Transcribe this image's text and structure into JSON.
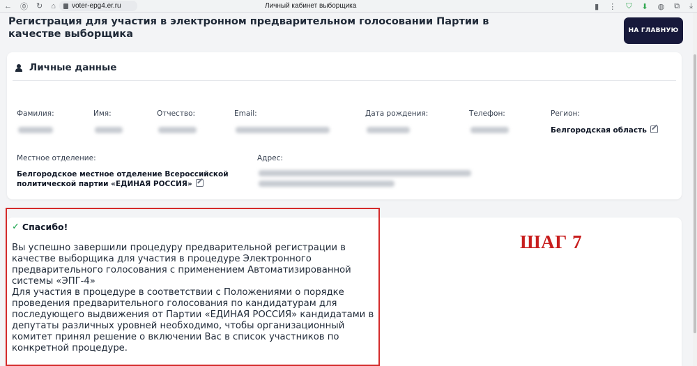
{
  "browser": {
    "url": "voter-epg4.er.ru",
    "tab_title": "Личный кабинет выборщика"
  },
  "header": {
    "title": "Регистрация для участия в электронном предварительном голосовании Партии в качестве выборщика",
    "home_button": "НА ГЛАВНУЮ"
  },
  "personal": {
    "heading": "Личные данные",
    "fields": {
      "surname_label": "Фамилия:",
      "name_label": "Имя:",
      "patronymic_label": "Отчество:",
      "email_label": "Email:",
      "birthdate_label": "Дата рождения:",
      "phone_label": "Телефон:",
      "region_label": "Регион:",
      "region_value": "Белгородская область",
      "branch_label": "Местное отделение:",
      "branch_value": "Белгородское местное отделение Всероссийской политической партии «ЕДИНАЯ РОССИЯ»",
      "address_label": "Адрес:"
    }
  },
  "thanks": {
    "title": "Спасибо!",
    "paragraph1": "Вы успешно завершили процедуру предварительной регистрации в качестве выборщика для участия в процедуре Электронного предварительного голосования с применением Автоматизированной системы «ЭПГ-4»",
    "paragraph2": "Для участия в процедуре в соответствии с Положениями о порядке проведения предварительного голосования по кандидатурам для последующего выдвижения от Партии «ЕДИНАЯ РОССИЯ» кандидатами в депутаты различных уровней необходимо, чтобы организационный комитет принял решение о включении Вас в список участников по конкретной процедуре."
  },
  "annotation": {
    "step": "ШАГ 7"
  },
  "colors": {
    "home_button_bg": "#17193b",
    "frame_red": "#d42b2b",
    "step_red": "#c81e1e",
    "check_green": "#16a34a"
  },
  "icons": {
    "back": "arrow-left-icon",
    "forward": "arrow-right-icon",
    "reload": "reload-icon",
    "user": "user-icon",
    "edit": "edit-icon",
    "check": "check-icon"
  }
}
